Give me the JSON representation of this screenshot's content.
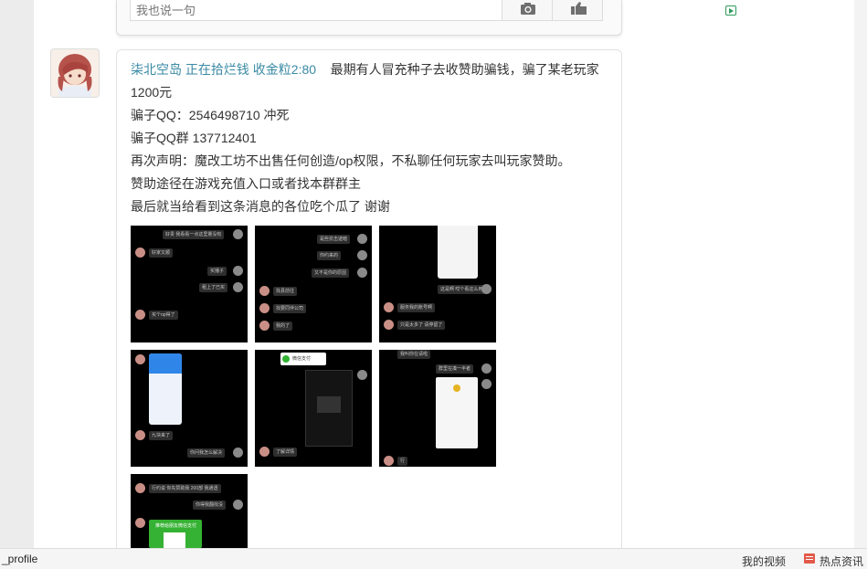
{
  "comment_box": {
    "placeholder": "我也说一句",
    "camera_icon": "camera-icon",
    "like_icon": "thumb-like-icon"
  },
  "post": {
    "author_line": "柒北空岛 正在拾烂钱 收金粒2:80",
    "lines": [
      "最期有人冒充种子去收赞助骗钱，骗了某老玩家1200元",
      "骗子QQ：2546498710 冲死",
      "骗子QQ群 137712401",
      "再次声明：魔改工坊不出售任何创造/op权限，不私聊任何玩家去叫玩家赞助。",
      "赞助途径在游戏充值入口或者找本群群主",
      "最后就当给看到这条消息的各位吃个瓜了 谢谢"
    ],
    "images": [
      {
        "name": "screenshot-1",
        "bubbles": [
          "好贵 我看看一点这里量没有",
          "好家又顺",
          "买播子",
          "租上了已买",
          "买个op得了"
        ]
      },
      {
        "name": "screenshot-2",
        "bubbles": [
          "是些抗击逮暗",
          "你约来的",
          "又不是你的原因",
          "找县前往",
          "找要同伴公司",
          "我的了"
        ]
      },
      {
        "name": "screenshot-3",
        "bubbles": [
          "这是啊 哎个看这么用",
          "服务我的账号啊",
          "只是太多了 请停留了"
        ]
      },
      {
        "name": "screenshot-4",
        "bubbles": [
          "九块来了",
          "你问我怎么解决"
        ]
      },
      {
        "name": "screenshot-5",
        "bubbles": [
          "微信支付",
          "了解详情"
        ]
      },
      {
        "name": "screenshot-6",
        "bubbles": [
          "我叫你在请啦",
          "群里在凑一半者",
          "行"
        ]
      },
      {
        "name": "screenshot-7",
        "bubbles": [
          "行约说 你先赞助我 200部 我通透",
          "你得我翻找没",
          "推荐给朋友微信支付"
        ]
      }
    ]
  },
  "status_bar": {
    "url_text": "_profile",
    "video_label": "我的视频",
    "hot_label": "热点资讯"
  }
}
